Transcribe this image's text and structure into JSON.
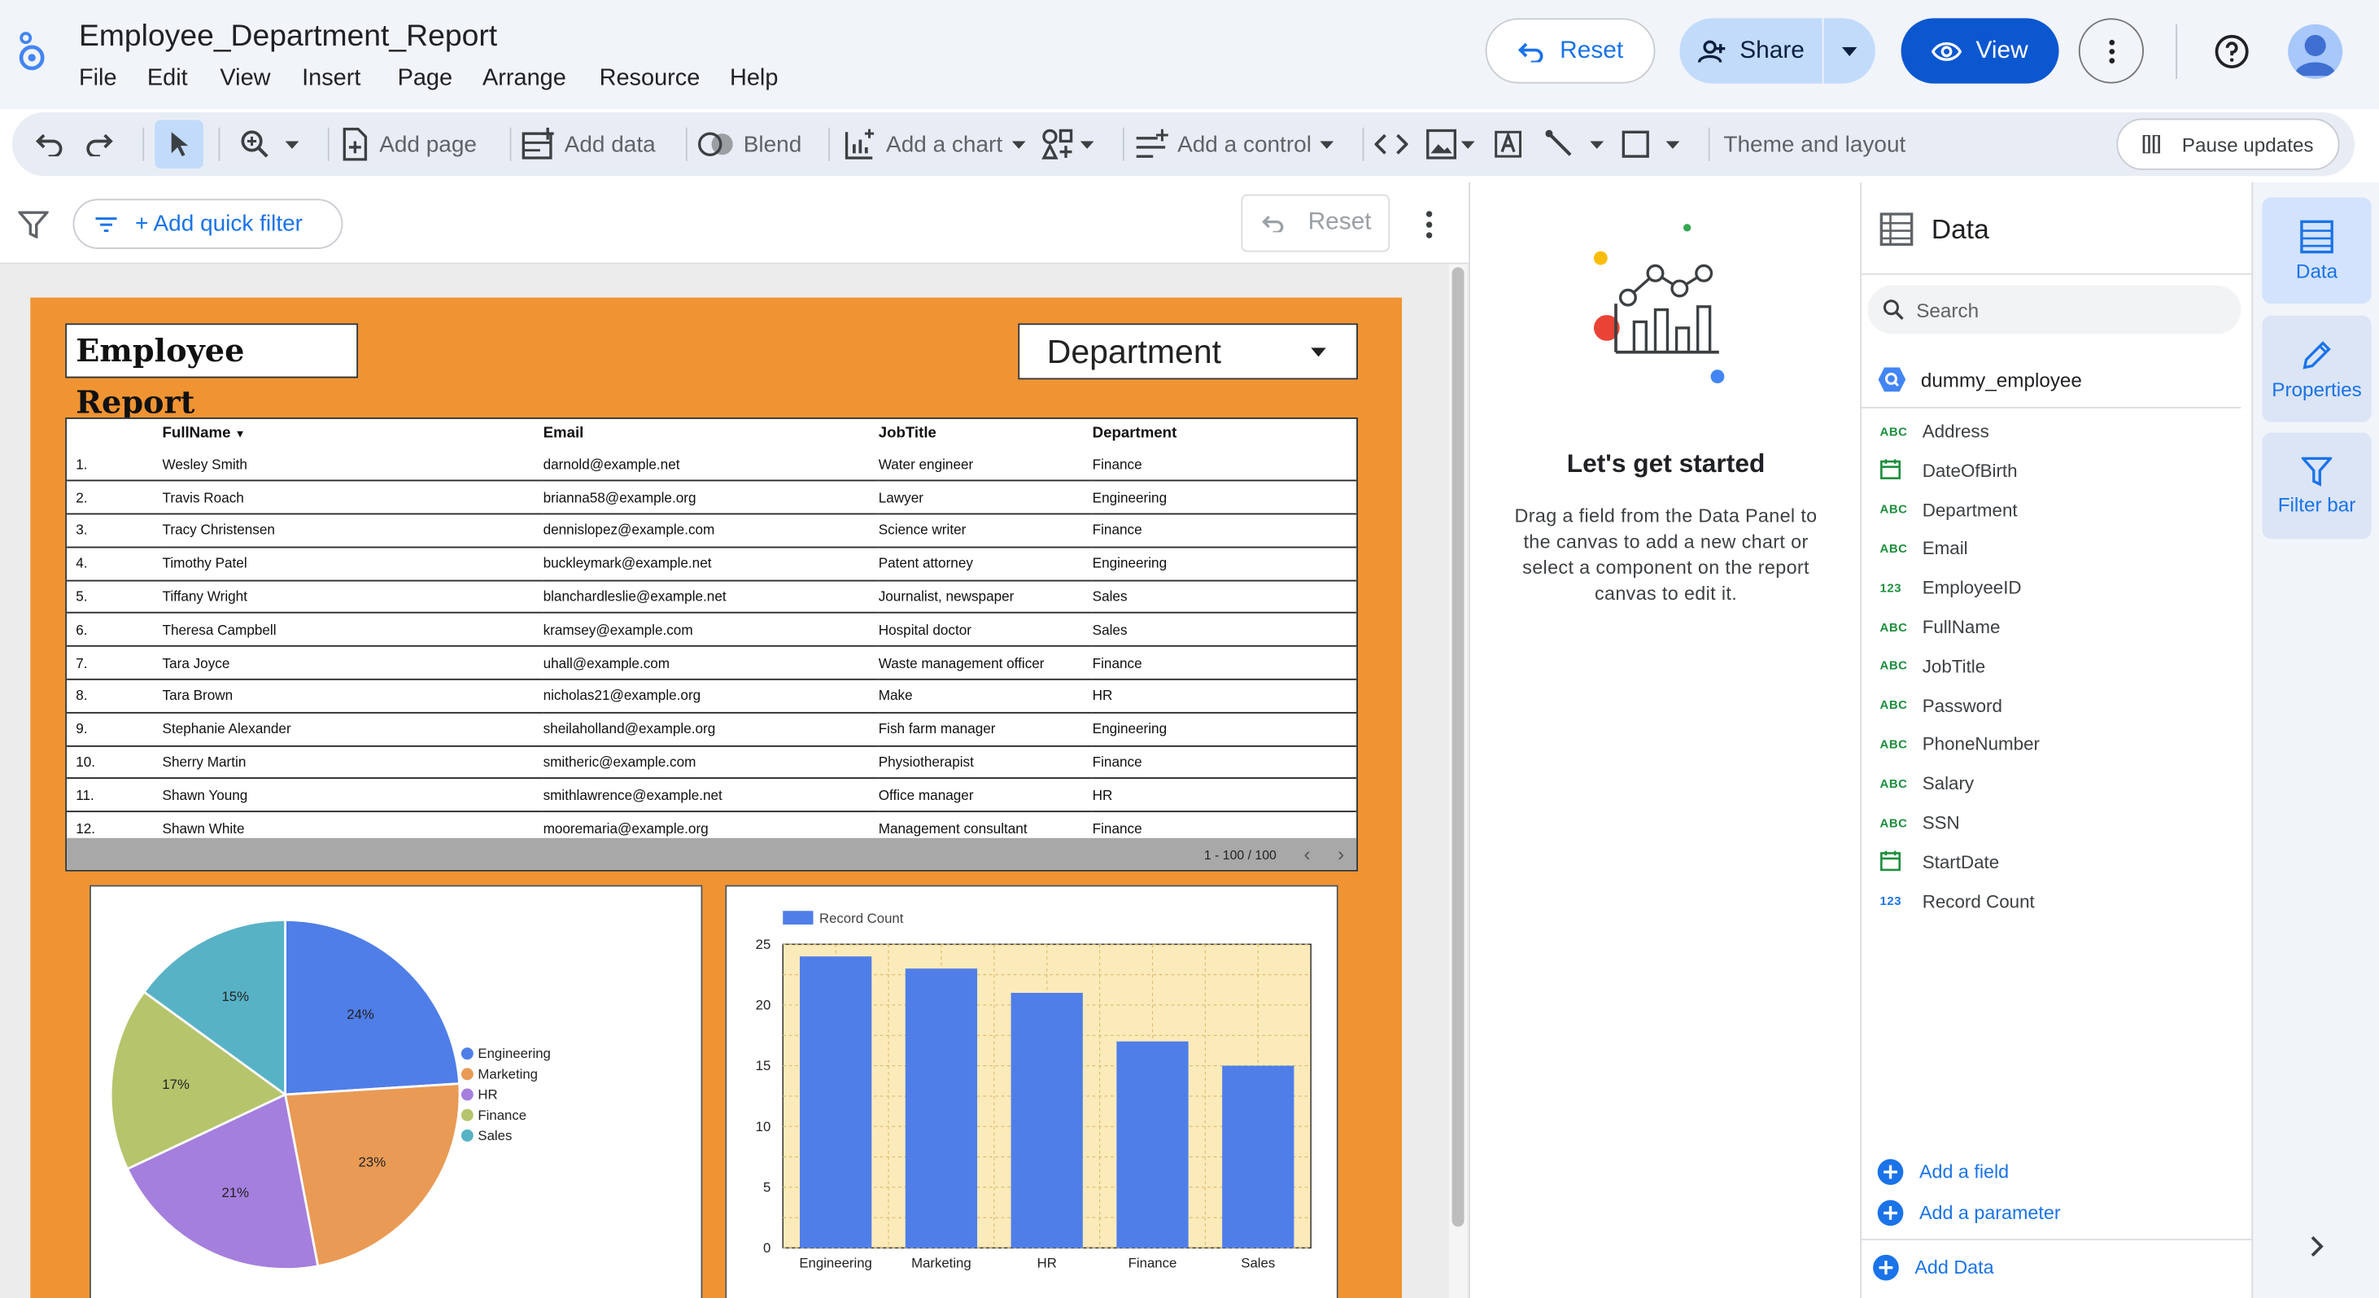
{
  "app": {
    "doc_title": "Employee_Department_Report",
    "menu": [
      "File",
      "Edit",
      "View",
      "Insert",
      "Page",
      "Arrange",
      "Resource",
      "Help"
    ],
    "reset_label": "Reset",
    "share_label": "Share",
    "view_label": "View"
  },
  "toolbar": {
    "add_page": "Add page",
    "add_data": "Add data",
    "blend": "Blend",
    "add_chart": "Add a chart",
    "add_control": "Add a control",
    "theme": "Theme and layout",
    "pause": "Pause updates"
  },
  "filterbar": {
    "add_filter": "+ Add quick filter",
    "reset": "Reset"
  },
  "report": {
    "title": "Employee Report",
    "dropdown": "Department",
    "columns": [
      "FullName",
      "Email",
      "JobTitle",
      "Department"
    ],
    "rows": [
      [
        "1.",
        "Wesley Smith",
        "darnold@example.net",
        "Water engineer",
        "Finance"
      ],
      [
        "2.",
        "Travis Roach",
        "brianna58@example.org",
        "Lawyer",
        "Engineering"
      ],
      [
        "3.",
        "Tracy Christensen",
        "dennislopez@example.com",
        "Science writer",
        "Finance"
      ],
      [
        "4.",
        "Timothy Patel",
        "buckleymark@example.net",
        "Patent attorney",
        "Engineering"
      ],
      [
        "5.",
        "Tiffany Wright",
        "blanchardleslie@example.net",
        "Journalist, newspaper",
        "Sales"
      ],
      [
        "6.",
        "Theresa Campbell",
        "kramsey@example.com",
        "Hospital doctor",
        "Sales"
      ],
      [
        "7.",
        "Tara Joyce",
        "uhall@example.com",
        "Waste management officer",
        "Finance"
      ],
      [
        "8.",
        "Tara Brown",
        "nicholas21@example.org",
        "Make",
        "HR"
      ],
      [
        "9.",
        "Stephanie Alexander",
        "sheilaholland@example.org",
        "Fish farm manager",
        "Engineering"
      ],
      [
        "10.",
        "Sherry Martin",
        "smitheric@example.com",
        "Physiotherapist",
        "Finance"
      ],
      [
        "11.",
        "Shawn Young",
        "smithlawrence@example.net",
        "Office manager",
        "HR"
      ],
      [
        "12.",
        "Shawn White",
        "mooremaria@example.org",
        "Management consultant",
        "Finance"
      ]
    ],
    "pagination": "1 - 100 / 100"
  },
  "chart_data": [
    {
      "type": "pie",
      "categories": [
        "Engineering",
        "Marketing",
        "HR",
        "Finance",
        "Sales"
      ],
      "values": [
        24,
        23,
        21,
        17,
        15
      ],
      "labels": [
        "24%",
        "23%",
        "21%",
        "17%",
        "15%"
      ],
      "colors": [
        "#4f7ee8",
        "#e99a55",
        "#a57fde",
        "#b6c46c",
        "#58b2c6"
      ],
      "legend": "right"
    },
    {
      "type": "bar",
      "categories": [
        "Engineering",
        "Marketing",
        "HR",
        "Finance",
        "Sales"
      ],
      "series": [
        {
          "name": "Record Count",
          "values": [
            24,
            23,
            21,
            17,
            15
          ]
        }
      ],
      "ylim": [
        0,
        25
      ],
      "yticks": [
        "0",
        "5",
        "10",
        "15",
        "20",
        "25"
      ],
      "bar_color": "#4f7ee8",
      "plot_background": "#fcebba",
      "grid": true,
      "legend": "top-left"
    }
  ],
  "props": {
    "heading": "Let's get started",
    "body": "Drag a field from the Data Panel to the canvas to add a new chart or select a component on the report canvas to edit it."
  },
  "data_panel": {
    "title": "Data",
    "search_placeholder": "Search",
    "source": "dummy_employee",
    "fields": [
      {
        "type": "ABC",
        "name": "Address"
      },
      {
        "type": "date",
        "name": "DateOfBirth"
      },
      {
        "type": "ABC",
        "name": "Department"
      },
      {
        "type": "ABC",
        "name": "Email"
      },
      {
        "type": "123",
        "name": "EmployeeID"
      },
      {
        "type": "ABC",
        "name": "FullName"
      },
      {
        "type": "ABC",
        "name": "JobTitle"
      },
      {
        "type": "ABC",
        "name": "Password"
      },
      {
        "type": "ABC",
        "name": "PhoneNumber"
      },
      {
        "type": "ABC",
        "name": "Salary"
      },
      {
        "type": "ABC",
        "name": "SSN"
      },
      {
        "type": "date",
        "name": "StartDate"
      },
      {
        "type": "123",
        "name": "Record Count"
      }
    ],
    "add_field": "Add a field",
    "add_parameter": "Add a parameter",
    "add_data": "Add Data"
  },
  "rail": {
    "data": "Data",
    "properties": "Properties",
    "filter_bar": "Filter bar"
  }
}
